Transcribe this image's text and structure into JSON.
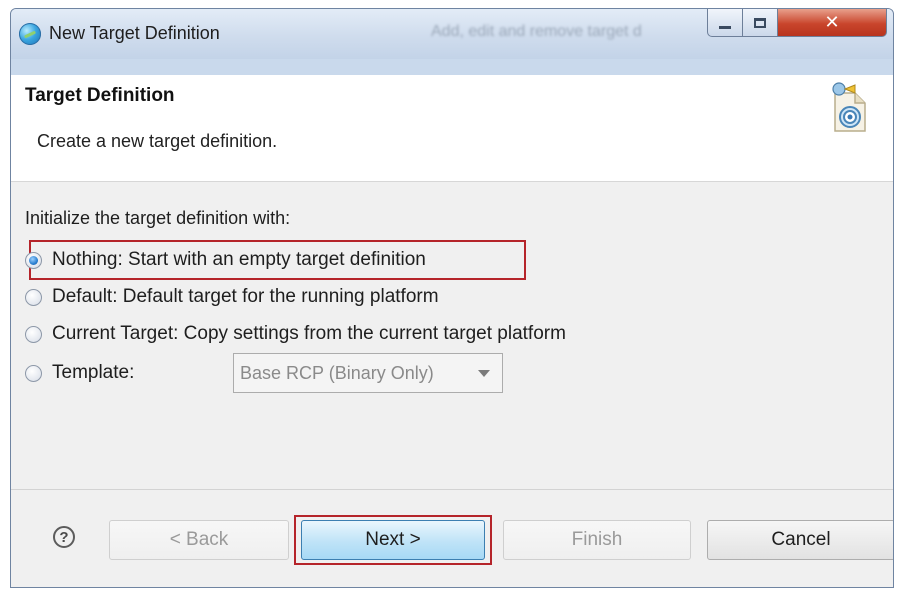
{
  "window": {
    "title": "New Target Definition",
    "background_title": "Add, edit and remove target d"
  },
  "header": {
    "title": "Target Definition",
    "description": "Create a new target definition."
  },
  "content": {
    "group_label": "Initialize the target definition with:",
    "options": [
      {
        "label": "Nothing: Start with an empty target definition",
        "selected": true
      },
      {
        "label": "Default: Default target for the running platform",
        "selected": false
      },
      {
        "label": "Current Target: Copy settings from the current target platform",
        "selected": false
      },
      {
        "label": "Template:",
        "selected": false
      }
    ],
    "template_select": {
      "value": "Base RCP (Binary Only)",
      "enabled": false
    }
  },
  "footer": {
    "help_label": "?",
    "back_label": "< Back",
    "next_label": "Next >",
    "finish_label": "Finish",
    "cancel_label": "Cancel"
  },
  "colors": {
    "highlight": "#b5242a",
    "default_button": "#bfe3f7",
    "close_button": "#c9452c"
  }
}
